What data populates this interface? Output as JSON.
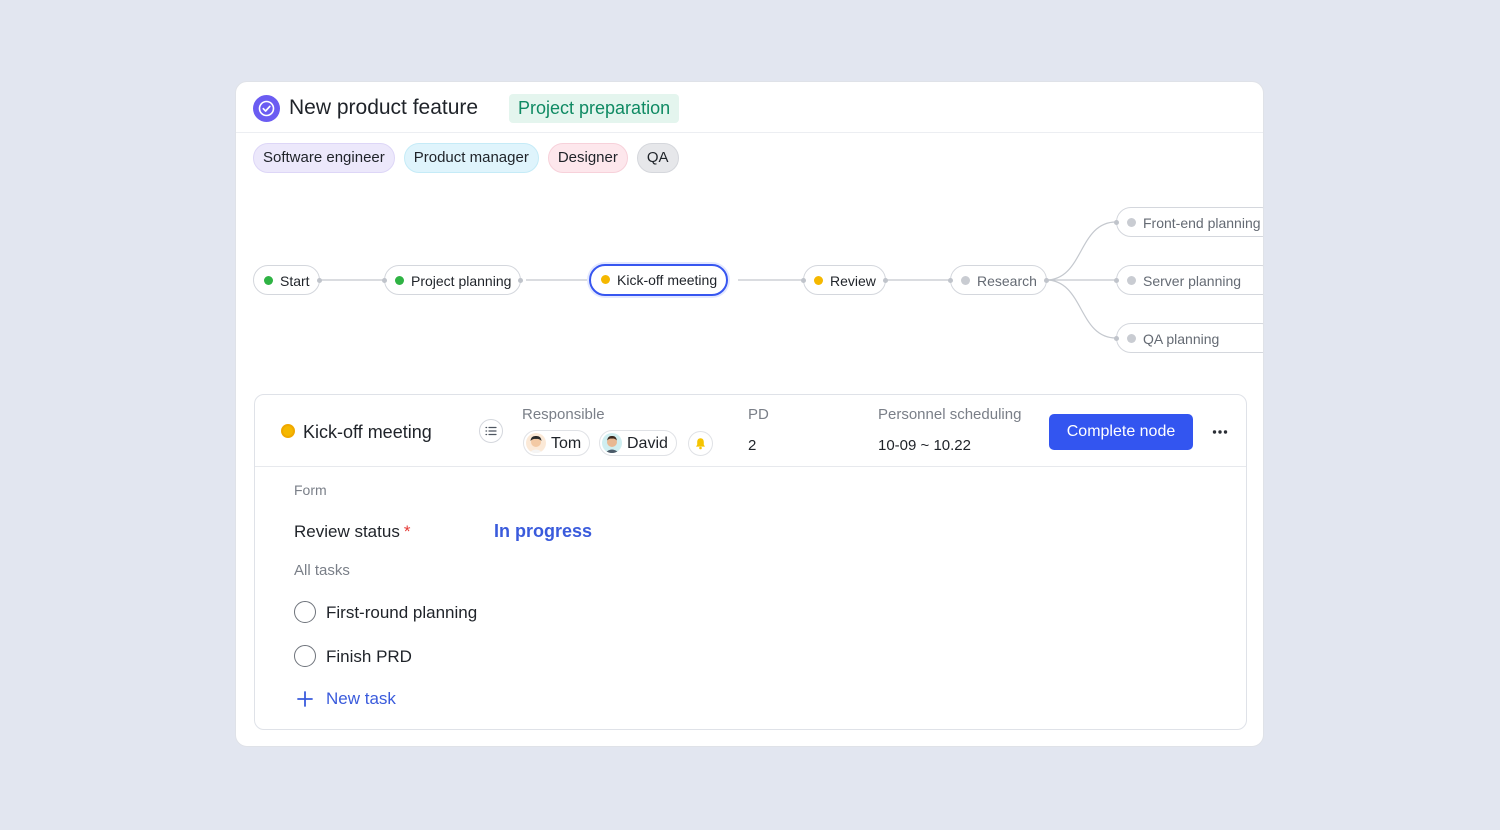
{
  "header": {
    "title": "New product feature",
    "stage_tag": "Project preparation"
  },
  "roles": [
    "Software engineer",
    "Product manager",
    "Designer",
    "QA"
  ],
  "workflow": {
    "nodes": [
      {
        "label": "Start",
        "status": "done"
      },
      {
        "label": "Project planning",
        "status": "done"
      },
      {
        "label": "Kick-off meeting",
        "status": "in-progress",
        "selected": true
      },
      {
        "label": "Review",
        "status": "in-progress"
      },
      {
        "label": "Research",
        "status": "pending"
      },
      {
        "label": "Front-end planning",
        "status": "pending"
      },
      {
        "label": "Server planning",
        "status": "pending"
      },
      {
        "label": "QA planning",
        "status": "pending"
      }
    ]
  },
  "detail": {
    "title": "Kick-off meeting",
    "responsible_label": "Responsible",
    "people": [
      "Tom",
      "David"
    ],
    "pd_label": "PD",
    "pd_value": "2",
    "scheduling_label": "Personnel scheduling",
    "scheduling_value": "10-09 ~ 10.22",
    "complete_button": "Complete node",
    "form_label": "Form",
    "review_status_label": "Review status",
    "required_mark": "*",
    "review_status_value": "In progress",
    "tasks_label": "All tasks",
    "tasks": [
      "First-round planning",
      "Finish PRD"
    ],
    "new_task_label": "New task"
  },
  "colors": {
    "accent": "#3355f0",
    "done": "#2fb344",
    "in_progress": "#f5b800",
    "pending": "#c9ccd2",
    "app_icon": "#6b5cf2"
  },
  "icons": [
    "check-circle-icon",
    "list-icon",
    "bell-icon",
    "more-icon",
    "plus-icon"
  ]
}
